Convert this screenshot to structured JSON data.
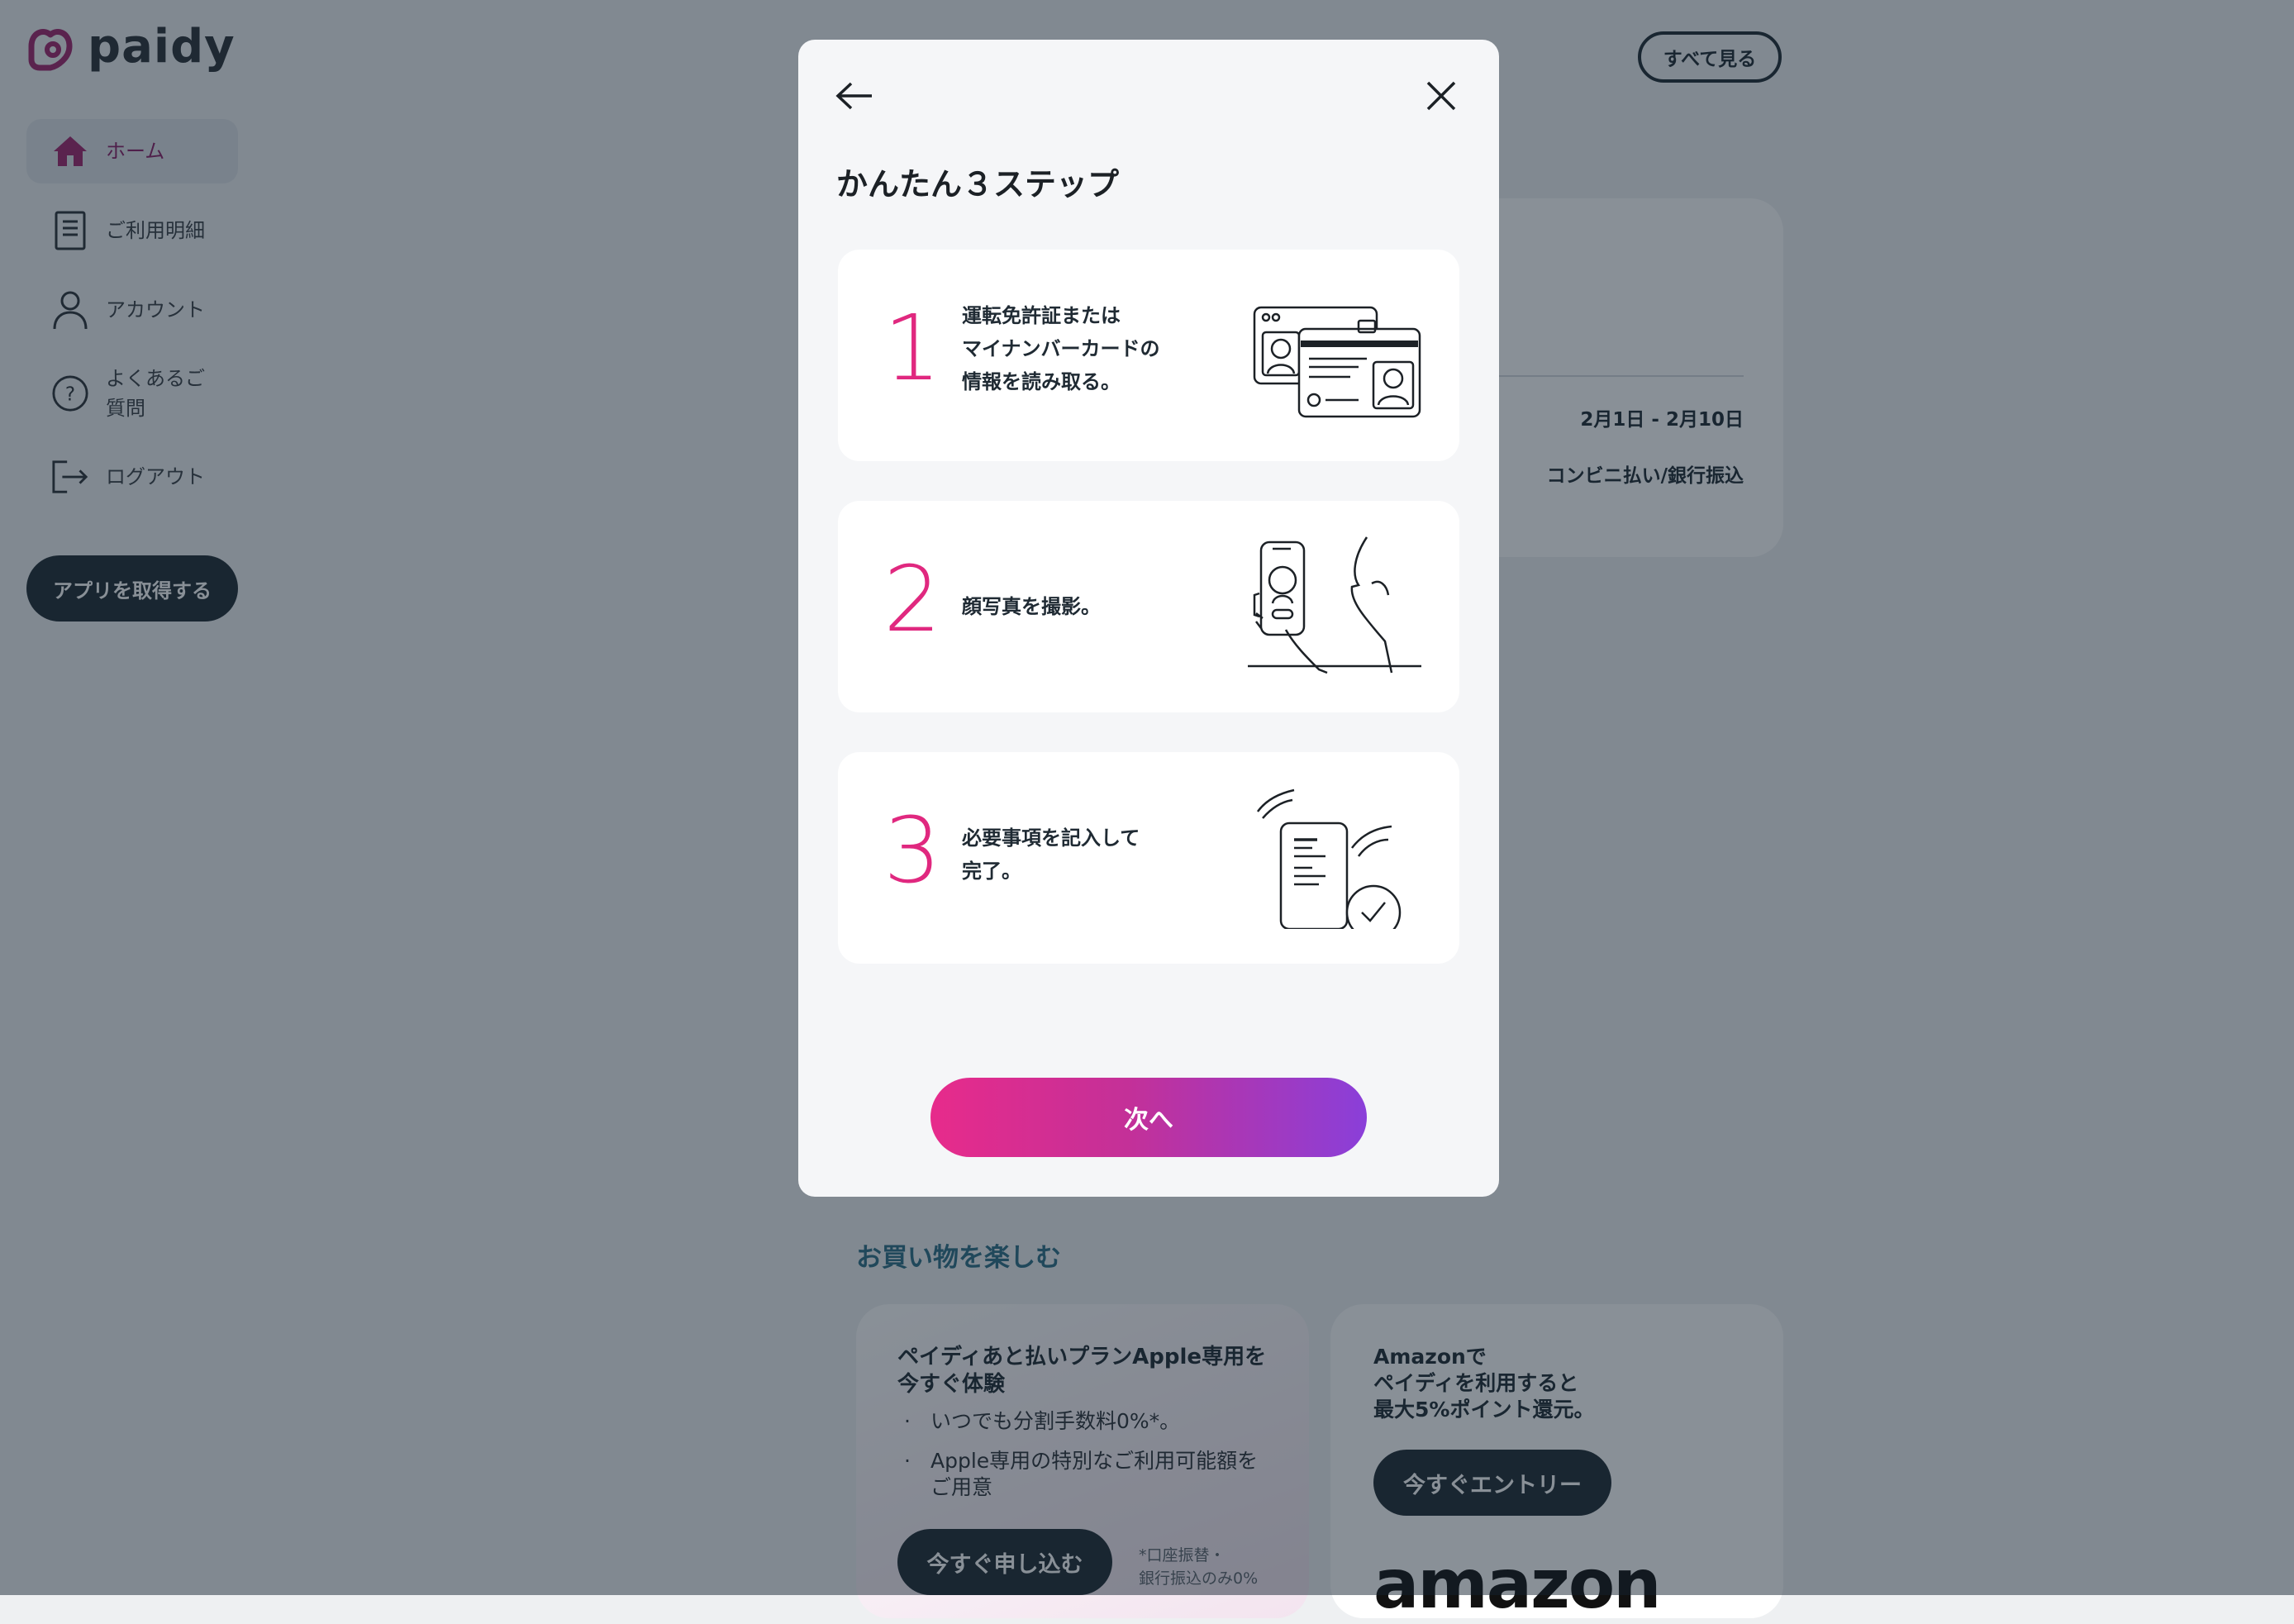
{
  "brand": {
    "logo_text": "paidy",
    "accent": "#e0287f"
  },
  "sidebar": {
    "items": [
      {
        "label": "ホーム",
        "icon": "home-icon",
        "active": true
      },
      {
        "label": "ご利用明細",
        "icon": "statement-icon",
        "active": false
      },
      {
        "label": "アカウント",
        "icon": "account-icon",
        "active": false
      },
      {
        "label": "よくあるご\n質問",
        "icon": "help-icon",
        "active": false
      },
      {
        "label": "ログアウト",
        "icon": "logout-icon",
        "active": false
      }
    ],
    "app_button": "アプリを取得する"
  },
  "header": {
    "see_all": "すべて見る"
  },
  "billing": {
    "period": "2月1日 - 2月10日",
    "method": "コンビニ払い/銀行振込"
  },
  "shopping": {
    "title": "お買い物を楽しむ",
    "promo_apple": {
      "title": "ペイディあと払いプランApple専用を\n今すぐ体験",
      "bullets": [
        "いつでも分割手数料0%*。",
        "Apple専用の特別なご利用可能額を\nご用意"
      ],
      "button": "今すぐ申し込む",
      "note": "*口座振替・\n銀行振込のみ0%"
    },
    "promo_amazon": {
      "title": "Amazonで\nペイディを利用すると\n最大5%ポイント還元。",
      "button": "今すぐエントリー",
      "logo_text": "amazon"
    }
  },
  "modal": {
    "title": "かんたん３ステップ",
    "steps": [
      {
        "number": "1",
        "text": "運転免許証または\nマイナンバーカードの\n情報を読み取る。",
        "illustration": "id-cards-illustration"
      },
      {
        "number": "2",
        "text": "顔写真を撮影。",
        "illustration": "selfie-illustration"
      },
      {
        "number": "3",
        "text": "必要事項を記入して\n完了。",
        "illustration": "form-complete-illustration"
      }
    ],
    "next_button": "次へ"
  }
}
